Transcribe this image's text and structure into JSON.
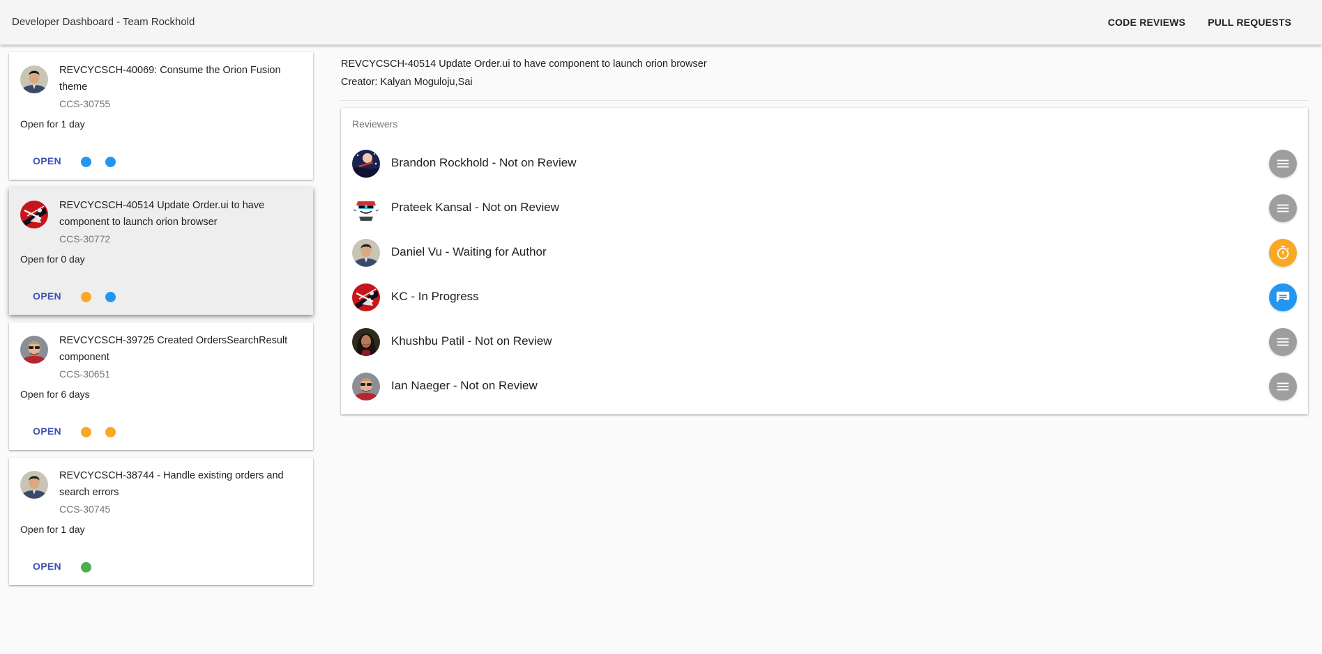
{
  "app": {
    "title": "Developer Dashboard - Team Rockhold",
    "nav": [
      "CODE REVIEWS",
      "PULL REQUESTS"
    ]
  },
  "colors": {
    "primary": "#3f51b5",
    "blue": "#2196f3",
    "orange": "#f9a825",
    "green": "#4caf50",
    "grey": "#9e9e9e"
  },
  "pull_requests": [
    {
      "title": "REVCYCSCH-40069: Consume the Orion Fusion theme",
      "id": "CCS-30755",
      "open_for": "Open for 1 day",
      "status": "OPEN",
      "avatar": "asian-man",
      "dots": [
        "blue",
        "blue"
      ]
    },
    {
      "title": "REVCYCSCH-40514 Update Order.ui to have component to launch orion browser",
      "id": "CCS-30772",
      "open_for": "Open for 0 day",
      "status": "OPEN",
      "avatar": "spiderman",
      "dots": [
        "orange",
        "blue"
      ],
      "selected": true
    },
    {
      "title": "REVCYCSCH-39725 Created OrdersSearchResult component",
      "id": "CCS-30651",
      "open_for": "Open for 6 days",
      "status": "OPEN",
      "avatar": "sunglasses-man",
      "dots": [
        "orange",
        "orange"
      ]
    },
    {
      "title": "REVCYCSCH-38744 - Handle existing orders and search errors",
      "id": "CCS-30745",
      "open_for": "Open for 1 day",
      "status": "OPEN",
      "avatar": "asian-man",
      "dots": [
        "green"
      ]
    }
  ],
  "detail": {
    "title": "REVCYCSCH-40514 Update Order.ui to have component to launch orion browser",
    "creator": "Creator: Kalyan Moguloju,Sai",
    "reviewers_label": "Reviewers",
    "reviewers": [
      {
        "name": "Brandon Rockhold - Not on Review",
        "avatar": "night-sky",
        "action": "menu-icon",
        "color": "grey"
      },
      {
        "name": "Prateek Kansal - Not on Review",
        "avatar": "cartoon",
        "action": "menu-icon",
        "color": "grey"
      },
      {
        "name": "Daniel Vu - Waiting for Author",
        "avatar": "asian-man",
        "action": "timer-icon",
        "color": "orange"
      },
      {
        "name": "KC - In Progress",
        "avatar": "spiderman",
        "action": "comment-icon",
        "color": "blue"
      },
      {
        "name": "Khushbu Patil - Not on Review",
        "avatar": "woman",
        "action": "menu-icon",
        "color": "grey"
      },
      {
        "name": "Ian Naeger - Not on Review",
        "avatar": "sunglasses-man",
        "action": "menu-icon",
        "color": "grey"
      }
    ]
  }
}
